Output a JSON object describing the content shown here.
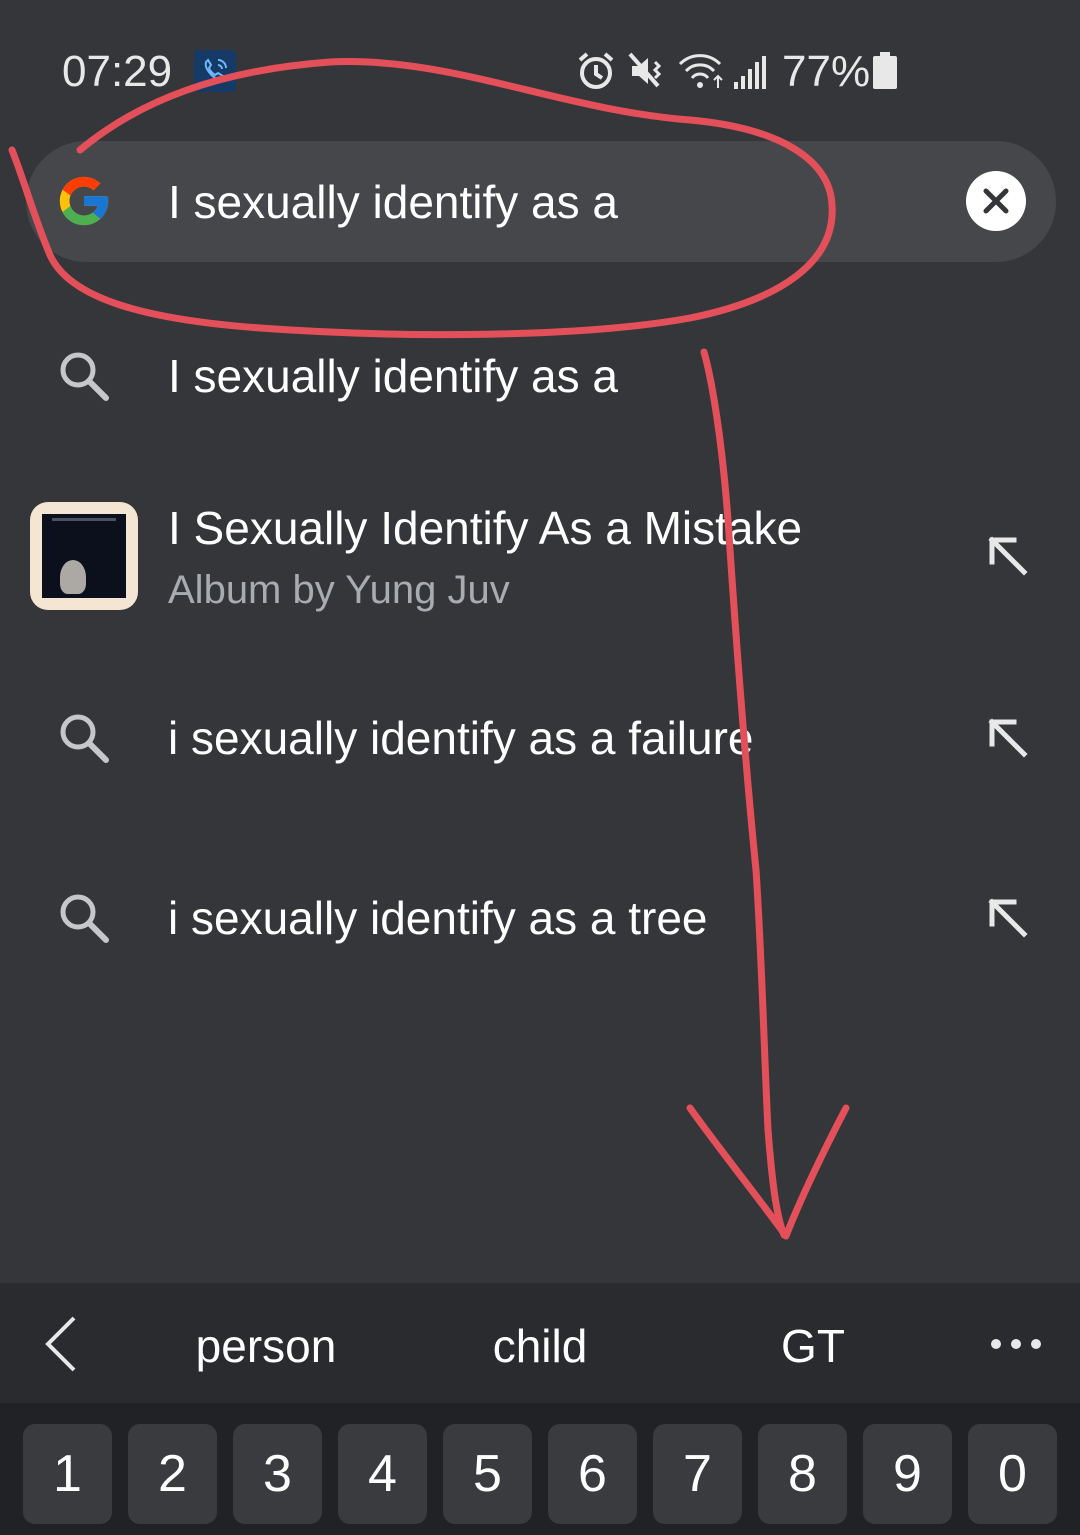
{
  "status_bar": {
    "time": "07:29",
    "battery": "77%",
    "icons": [
      "call-icon",
      "alarm-icon",
      "mute-icon",
      "wifi-icon",
      "signal-icon",
      "battery-icon"
    ]
  },
  "search": {
    "query": "I sexually identify as a",
    "logo": "google-g-icon",
    "clear_icon": "close-icon"
  },
  "suggestions": [
    {
      "type": "search",
      "text": "I sexually identify as a",
      "icon": "search-icon"
    },
    {
      "type": "album",
      "title": "I Sexually Identify As a Mistake",
      "subtitle": "Album by Yung Juv",
      "icon": "album-thumbnail"
    },
    {
      "type": "search",
      "text": "i sexually identify as a failure",
      "icon": "search-icon"
    },
    {
      "type": "search",
      "text": "i sexually identify as a tree",
      "icon": "search-icon"
    }
  ],
  "keyboard": {
    "suggestions": [
      "person",
      "child",
      "GT"
    ],
    "number_row": [
      "1",
      "2",
      "3",
      "4",
      "5",
      "6",
      "7",
      "8",
      "9",
      "0"
    ]
  },
  "colors": {
    "background": "#35363a",
    "search_bar": "#45474b",
    "annotation": "#e4505a"
  }
}
